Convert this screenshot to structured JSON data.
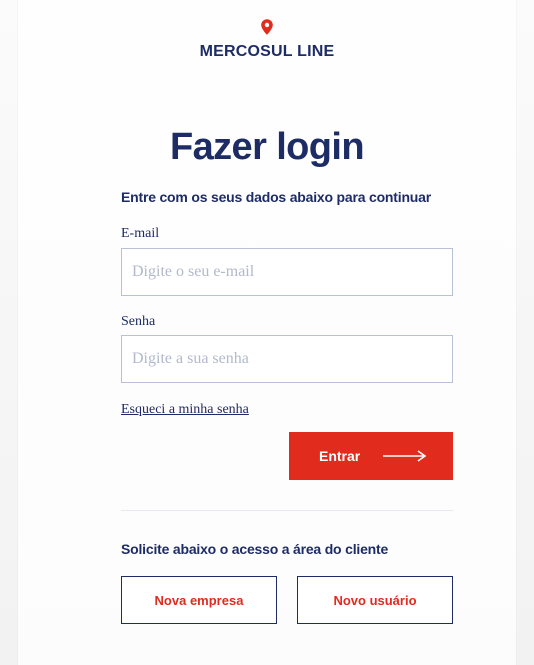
{
  "brand": {
    "name": "MERCOSUL LINE",
    "logo_icon": "location-pin-icon",
    "primary_color": "#e12b1c",
    "text_color": "#1e2c65"
  },
  "login": {
    "title": "Fazer login",
    "subtitle": "Entre com os seus dados abaixo para continuar",
    "email_label": "E-mail",
    "email_placeholder": "Digite o seu e-mail",
    "email_value": "",
    "password_label": "Senha",
    "password_placeholder": "Digite a sua senha",
    "password_value": "",
    "forgot_link": "Esqueci a minha senha",
    "submit_label": "Entrar",
    "submit_icon": "arrow-right-icon"
  },
  "access": {
    "text": "Solicite abaixo o acesso a área do cliente",
    "new_company_label": "Nova empresa",
    "new_user_label": "Novo usuário"
  }
}
